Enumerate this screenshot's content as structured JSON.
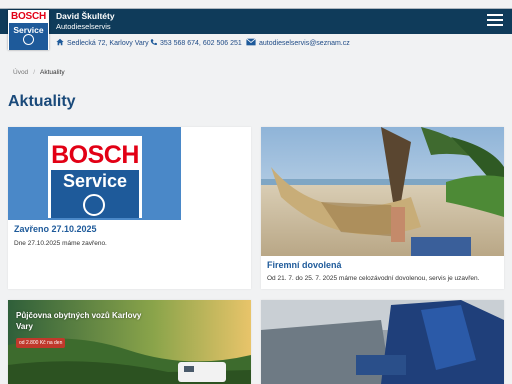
{
  "header": {
    "logo": {
      "brand": "BOSCH",
      "service": "Service"
    },
    "owner": "David Škultéty",
    "subtitle": "Autodieselservis",
    "menu_icon": "hamburger-icon"
  },
  "contact": {
    "address": "Sedlecká 72, Karlovy Vary",
    "phones": "353 568 674, 602 506 251",
    "email": "autodieselservis@seznam.cz"
  },
  "breadcrumb": {
    "home": "Úvod",
    "separator": "/",
    "current": "Aktuality"
  },
  "page_title": "Aktuality",
  "cards": [
    {
      "title": "Zavřeno 27.10.2025",
      "text": "Dne 27.10.2025 máme zavřeno.",
      "image": {
        "brand": "BOSCH",
        "service": "Service"
      }
    },
    {
      "title": "Firemní dovolená",
      "text": "Od 21. 7. do 25. 7. 2025 máme celozávodní dovolenou, servis je uzavřen."
    },
    {
      "ad_title": "Půjčovna obytných vozů Karlovy Vary",
      "ad_pill": "od 2.800 Kč na den"
    },
    {}
  ],
  "colors": {
    "header": "#0f3b5a",
    "accent": "#1e5a9a",
    "bosch_red": "#e20015"
  }
}
